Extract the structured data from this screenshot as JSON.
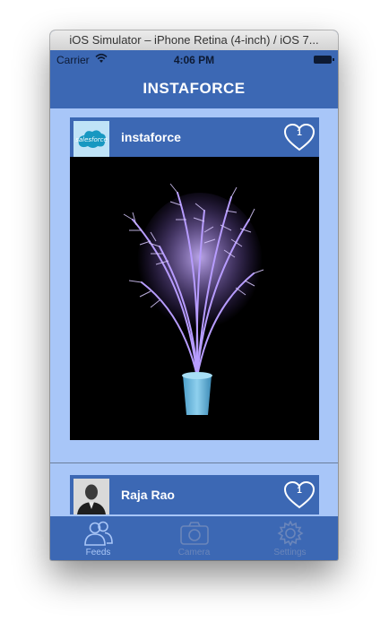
{
  "window": {
    "title": "iOS Simulator – iPhone Retina (4-inch) / iOS 7..."
  },
  "status_bar": {
    "carrier": "Carrier",
    "time": "4:06 PM"
  },
  "nav": {
    "title": "INSTAFORCE"
  },
  "posts": [
    {
      "username": "instaforce",
      "likes": "1",
      "avatar_icon": "salesforce-logo-icon",
      "photo": "purple-palm-plant-in-blue-pot"
    },
    {
      "username": "Raja Rao",
      "likes": "1",
      "avatar_icon": "user-photo"
    }
  ],
  "tabs": [
    {
      "label": "Feeds",
      "icon": "people-icon",
      "active": true
    },
    {
      "label": "Camera",
      "icon": "camera-icon",
      "active": false
    },
    {
      "label": "Settings",
      "icon": "gear-icon",
      "active": false
    }
  ],
  "colors": {
    "bar": "#3c68b4",
    "background": "#a8c6f8",
    "tab_active": "#a9c6f7",
    "tab_inactive": "#6b86ba"
  }
}
